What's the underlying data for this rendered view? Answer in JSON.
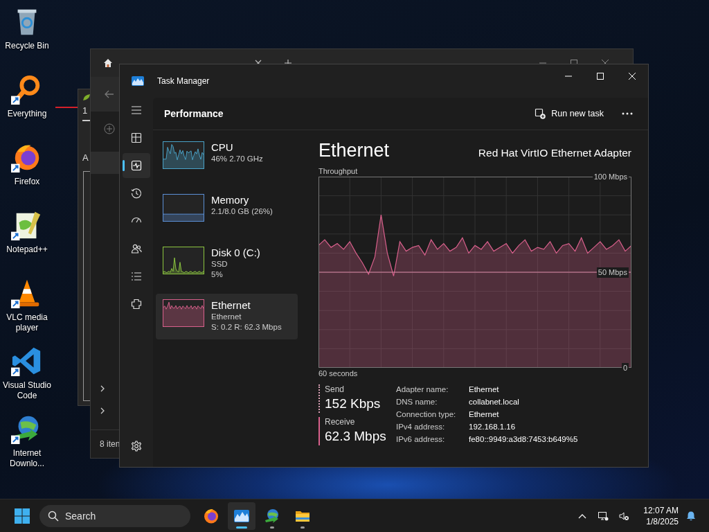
{
  "desktop_icons": [
    {
      "kind": "recycle-bin",
      "label": "Recycle Bin",
      "shortcut": false
    },
    {
      "kind": "everything",
      "label": "Everything",
      "shortcut": true
    },
    {
      "kind": "firefox",
      "label": "Firefox",
      "shortcut": true
    },
    {
      "kind": "notepad",
      "label": "Notepad++",
      "shortcut": true
    },
    {
      "kind": "vlc",
      "label": "VLC media player",
      "shortcut": true
    },
    {
      "kind": "vscode",
      "label": "Visual Studio Code",
      "shortcut": true
    },
    {
      "kind": "idm",
      "label": "Internet Downlo...",
      "shortcut": true
    }
  ],
  "back_window": {
    "fragments": [
      "1",
      "A"
    ]
  },
  "explorer_window": {
    "status_text": "8 iten"
  },
  "task_manager": {
    "title": "Task Manager",
    "nav": [
      {
        "kind": "processes",
        "selected": false
      },
      {
        "kind": "performance",
        "selected": true
      },
      {
        "kind": "history",
        "selected": false
      },
      {
        "kind": "startup",
        "selected": false
      },
      {
        "kind": "users",
        "selected": false
      },
      {
        "kind": "details",
        "selected": false
      },
      {
        "kind": "services",
        "selected": false
      }
    ],
    "section_title": "Performance",
    "run_new_task": "Run new task",
    "devices": [
      {
        "kind": "cpu",
        "name": "CPU",
        "details": [
          "46% 2.70 GHz"
        ],
        "color": "#4aa3c8",
        "selected": false
      },
      {
        "kind": "memory",
        "name": "Memory",
        "details": [
          "2.1/8.0 GB (26%)"
        ],
        "color": "#5b8fd6",
        "selected": false
      },
      {
        "kind": "disk",
        "name": "Disk 0 (C:)",
        "details": [
          "SSD",
          "5%"
        ],
        "color": "#8cc63f",
        "selected": false
      },
      {
        "kind": "network",
        "name": "Ethernet",
        "details": [
          "Ethernet",
          "S: 0.2 R: 62.3 Mbps"
        ],
        "color": "#d9608c",
        "selected": true
      }
    ],
    "detail": {
      "title": "Ethernet",
      "adapter": "Red Hat VirtIO Ethernet Adapter",
      "chart_data": {
        "type": "area",
        "title": "Throughput",
        "xlabel": "60 seconds",
        "ylim": [
          0,
          100
        ],
        "yticks": [
          {
            "value": 0,
            "label": "0"
          },
          {
            "value": 50,
            "label": "50 Mbps"
          },
          {
            "value": 100,
            "label": "100 Mbps"
          }
        ],
        "grid": true,
        "ref_lines": [
          {
            "axis": "y",
            "value": 50,
            "color": "#d98aa6"
          }
        ],
        "series": [
          {
            "color": "#d9608c",
            "values": [
              64,
              67,
              63,
              65,
              62,
              66,
              60,
              55,
              49,
              58,
              80,
              60,
              48,
              66,
              61,
              63,
              64,
              59,
              67,
              62,
              65,
              61,
              63,
              68,
              60,
              64,
              62,
              66,
              61,
              63,
              65,
              60,
              64,
              67,
              61,
              63,
              62,
              66,
              60,
              64,
              65,
              61,
              68,
              60,
              63,
              66,
              62,
              64,
              67,
              61,
              64
            ]
          }
        ]
      },
      "rates": [
        {
          "kind": "send",
          "label": "Send",
          "value": "152 Kbps"
        },
        {
          "kind": "receive",
          "label": "Receive",
          "value": "62.3 Mbps"
        }
      ],
      "properties": [
        {
          "label": "Adapter name:",
          "value": "Ethernet"
        },
        {
          "label": "DNS name:",
          "value": "collabnet.local"
        },
        {
          "label": "Connection type:",
          "value": "Ethernet"
        },
        {
          "label": "IPv4 address:",
          "value": "192.168.1.16"
        },
        {
          "label": "IPv6 address:",
          "value": "fe80::9949:a3d8:7453:b649%5"
        }
      ]
    }
  },
  "taskbar": {
    "search_placeholder": "Search",
    "apps": [
      {
        "kind": "firefox",
        "running": false,
        "active": false
      },
      {
        "kind": "task-manager",
        "running": true,
        "active": true
      },
      {
        "kind": "idm",
        "running": true,
        "active": false
      },
      {
        "kind": "explorer",
        "running": true,
        "active": false
      }
    ],
    "time": "12:07 AM",
    "date": "1/8/2025"
  }
}
